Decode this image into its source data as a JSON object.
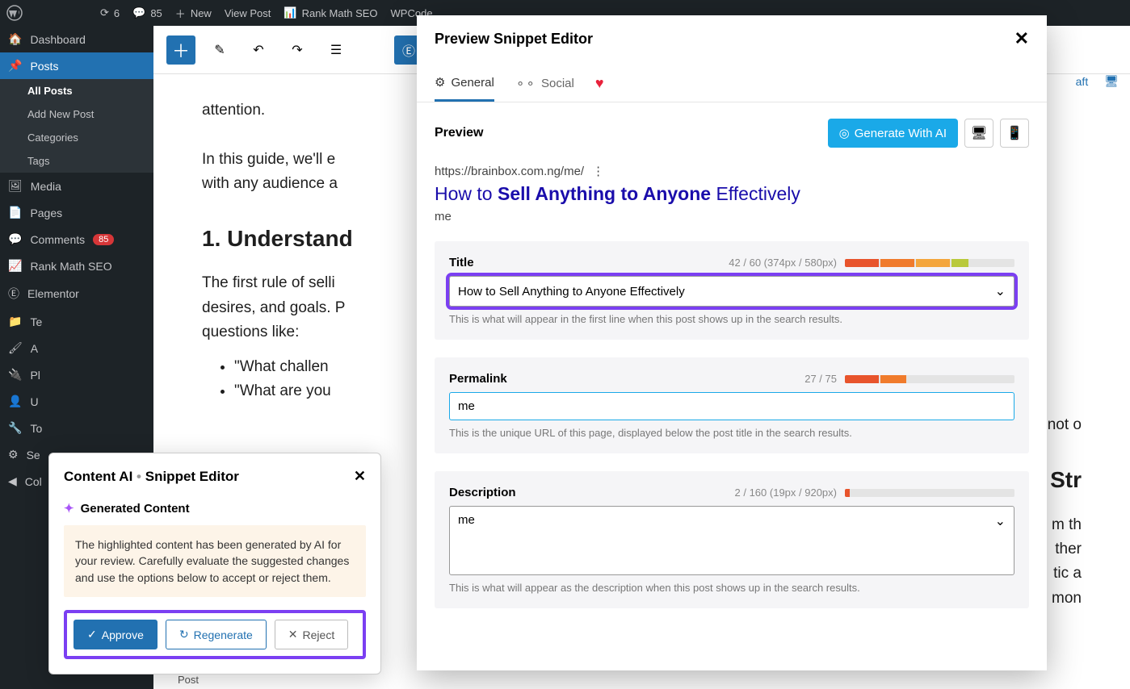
{
  "adminbar": {
    "updates": "6",
    "comments": "85",
    "new": "New",
    "view_post": "View Post",
    "rank_math": "Rank Math SEO",
    "wpcode": "WPCode"
  },
  "sidebar": {
    "dashboard": "Dashboard",
    "posts": "Posts",
    "posts_sub": [
      "All Posts",
      "Add New Post",
      "Categories",
      "Tags"
    ],
    "media": "Media",
    "pages": "Pages",
    "comments": "Comments",
    "comments_count": "85",
    "rankmath": "Rank Math SEO",
    "elementor": "Elementor",
    "templates": "Te",
    "appearance": "A",
    "plugins": "Pl",
    "users": "U",
    "tools": "To",
    "settings": "Se",
    "collapse": "Col"
  },
  "editor": {
    "p1": "attention.",
    "p2": "In this guide, we'll e",
    "p2b": "with any audience a",
    "h1": "1. Understand",
    "p3": "The first rule of selli",
    "p3b": "desires, and goals. P",
    "p3c": "questions like:",
    "li1": "\"What challen",
    "li2": "\"What are you",
    "p4": "not o",
    "h2": "Str",
    "p5": "m th",
    "p5b": "ther",
    "p6": "tic a",
    "p6b": "mon",
    "footer": "Post",
    "draft": "aft"
  },
  "ai": {
    "title_a": "Content AI",
    "title_b": "Snippet Editor",
    "gc": "Generated Content",
    "note": "The highlighted content has been generated by AI for your review. Carefully evaluate the suggested changes and use the options below to accept or reject them.",
    "approve": "Approve",
    "regenerate": "Regenerate",
    "reject": "Reject"
  },
  "snippet": {
    "header": "Preview Snippet Editor",
    "tab_general": "General",
    "tab_social": "Social",
    "preview_label": "Preview",
    "generate": "Generate With AI",
    "url": "https://brainbox.com.ng/me/",
    "title_plain_a": "How to ",
    "title_bold": "Sell Anything to Anyone",
    "title_plain_b": " Effectively",
    "desc_preview": "me",
    "title_section": {
      "label": "Title",
      "counter": "42 / 60 (374px / 580px)",
      "value": "How to Sell Anything to Anyone Effectively",
      "help": "This is what will appear in the first line when this post shows up in the search results."
    },
    "permalink_section": {
      "label": "Permalink",
      "counter": "27 / 75",
      "value": "me",
      "help": "This is the unique URL of this page, displayed below the post title in the search results."
    },
    "description_section": {
      "label": "Description",
      "counter": "2 / 160 (19px / 920px)",
      "value": "me",
      "help": "This is what will appear as the description when this post shows up in the search results."
    }
  }
}
